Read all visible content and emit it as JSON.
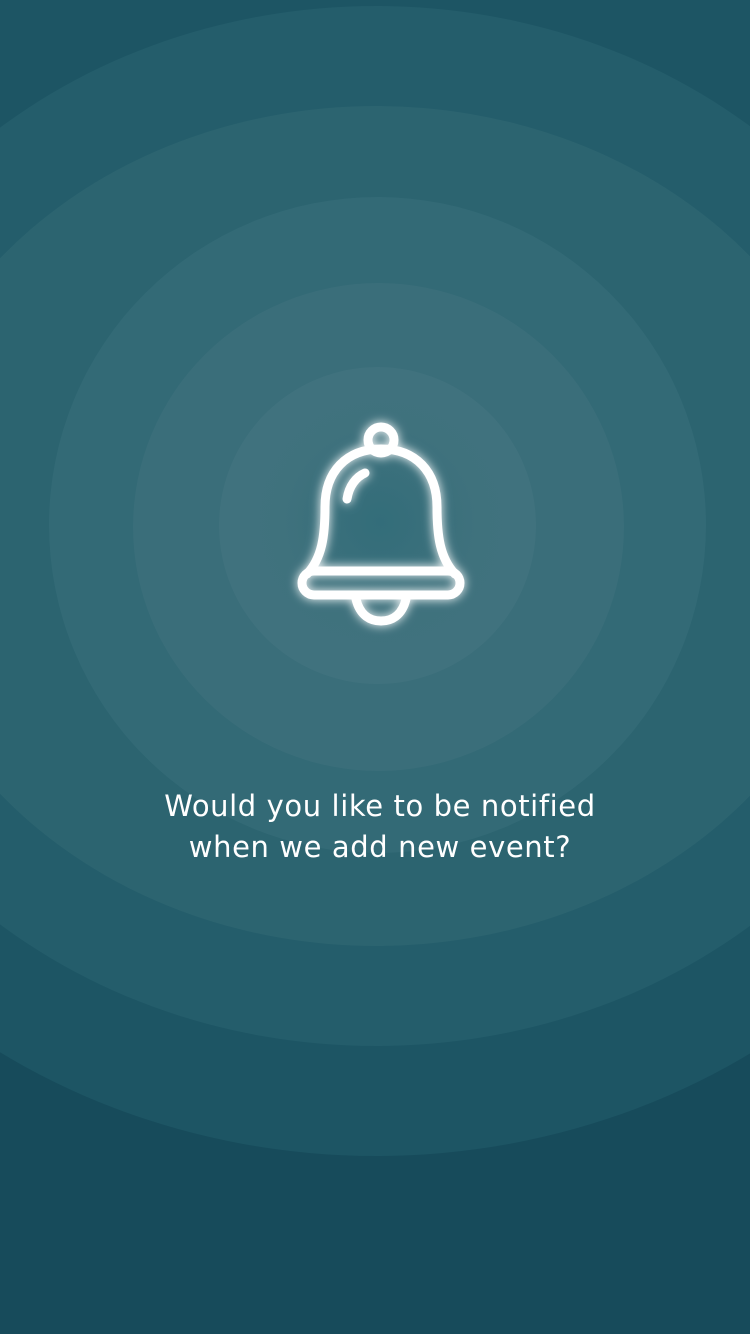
{
  "screen": {
    "background_color": "#174b5b",
    "ring_colors": [
      "#1d5564",
      "#245d6b",
      "#2c6470",
      "#336a76",
      "#3a6e7a",
      "#40727e"
    ]
  },
  "notification_prompt": {
    "icon": "bell-icon",
    "icon_color": "#ffffff",
    "question_line_1": "Would you like to be notified",
    "question_line_2": "when we add new event?"
  }
}
